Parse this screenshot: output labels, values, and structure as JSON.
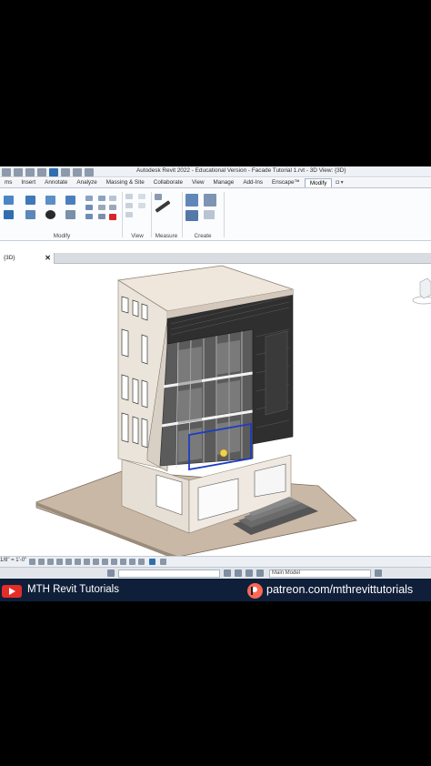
{
  "window": {
    "title": "Autodesk Revit 2022 - Educational Version - Facade Tutorial 1.rvt - 3D View: {3D}"
  },
  "ribbon_tabs": [
    {
      "label": "ms",
      "active": false
    },
    {
      "label": "Insert",
      "active": false
    },
    {
      "label": "Annotate",
      "active": false
    },
    {
      "label": "Analyze",
      "active": false
    },
    {
      "label": "Massing & Site",
      "active": false
    },
    {
      "label": "Collaborate",
      "active": false
    },
    {
      "label": "View",
      "active": false
    },
    {
      "label": "Manage",
      "active": false
    },
    {
      "label": "Add-Ins",
      "active": false
    },
    {
      "label": "Enscape™",
      "active": false
    },
    {
      "label": "Modify",
      "active": true
    }
  ],
  "ribbon_panels": {
    "modify": "Modify",
    "view": "View",
    "measure": "Measure",
    "create": "Create"
  },
  "view_tab": {
    "label": "{3D}",
    "close_glyph": "✕"
  },
  "view_control": {
    "scale": "1/8\" = 1'-0\""
  },
  "status": {
    "workset_value": "",
    "model_value": "Main Model"
  },
  "branding": {
    "left_text": "MTH Revit Tutorials",
    "right_text": "patreon.com/mthrevittutorials",
    "youtube_color": "#e52d27",
    "patreon_color": "#f96854"
  },
  "icons": [
    "quick-access-icons",
    "modify-tool-icons",
    "measure-icon",
    "create-group-icon",
    "viewcube-icon",
    "youtube-icon",
    "patreon-icon"
  ]
}
